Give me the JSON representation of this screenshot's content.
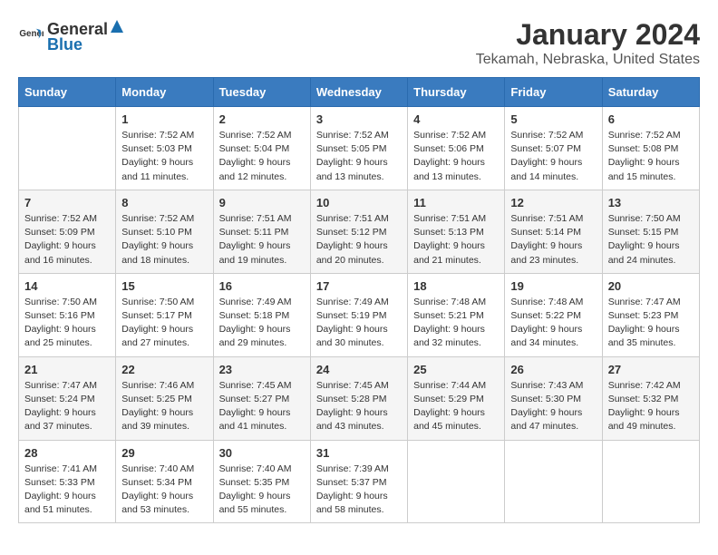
{
  "logo": {
    "general": "General",
    "blue": "Blue"
  },
  "title": "January 2024",
  "location": "Tekamah, Nebraska, United States",
  "days_of_week": [
    "Sunday",
    "Monday",
    "Tuesday",
    "Wednesday",
    "Thursday",
    "Friday",
    "Saturday"
  ],
  "weeks": [
    [
      {
        "day": "",
        "info": ""
      },
      {
        "day": "1",
        "info": "Sunrise: 7:52 AM\nSunset: 5:03 PM\nDaylight: 9 hours\nand 11 minutes."
      },
      {
        "day": "2",
        "info": "Sunrise: 7:52 AM\nSunset: 5:04 PM\nDaylight: 9 hours\nand 12 minutes."
      },
      {
        "day": "3",
        "info": "Sunrise: 7:52 AM\nSunset: 5:05 PM\nDaylight: 9 hours\nand 13 minutes."
      },
      {
        "day": "4",
        "info": "Sunrise: 7:52 AM\nSunset: 5:06 PM\nDaylight: 9 hours\nand 13 minutes."
      },
      {
        "day": "5",
        "info": "Sunrise: 7:52 AM\nSunset: 5:07 PM\nDaylight: 9 hours\nand 14 minutes."
      },
      {
        "day": "6",
        "info": "Sunrise: 7:52 AM\nSunset: 5:08 PM\nDaylight: 9 hours\nand 15 minutes."
      }
    ],
    [
      {
        "day": "7",
        "info": "Sunrise: 7:52 AM\nSunset: 5:09 PM\nDaylight: 9 hours\nand 16 minutes."
      },
      {
        "day": "8",
        "info": "Sunrise: 7:52 AM\nSunset: 5:10 PM\nDaylight: 9 hours\nand 18 minutes."
      },
      {
        "day": "9",
        "info": "Sunrise: 7:51 AM\nSunset: 5:11 PM\nDaylight: 9 hours\nand 19 minutes."
      },
      {
        "day": "10",
        "info": "Sunrise: 7:51 AM\nSunset: 5:12 PM\nDaylight: 9 hours\nand 20 minutes."
      },
      {
        "day": "11",
        "info": "Sunrise: 7:51 AM\nSunset: 5:13 PM\nDaylight: 9 hours\nand 21 minutes."
      },
      {
        "day": "12",
        "info": "Sunrise: 7:51 AM\nSunset: 5:14 PM\nDaylight: 9 hours\nand 23 minutes."
      },
      {
        "day": "13",
        "info": "Sunrise: 7:50 AM\nSunset: 5:15 PM\nDaylight: 9 hours\nand 24 minutes."
      }
    ],
    [
      {
        "day": "14",
        "info": "Sunrise: 7:50 AM\nSunset: 5:16 PM\nDaylight: 9 hours\nand 25 minutes."
      },
      {
        "day": "15",
        "info": "Sunrise: 7:50 AM\nSunset: 5:17 PM\nDaylight: 9 hours\nand 27 minutes."
      },
      {
        "day": "16",
        "info": "Sunrise: 7:49 AM\nSunset: 5:18 PM\nDaylight: 9 hours\nand 29 minutes."
      },
      {
        "day": "17",
        "info": "Sunrise: 7:49 AM\nSunset: 5:19 PM\nDaylight: 9 hours\nand 30 minutes."
      },
      {
        "day": "18",
        "info": "Sunrise: 7:48 AM\nSunset: 5:21 PM\nDaylight: 9 hours\nand 32 minutes."
      },
      {
        "day": "19",
        "info": "Sunrise: 7:48 AM\nSunset: 5:22 PM\nDaylight: 9 hours\nand 34 minutes."
      },
      {
        "day": "20",
        "info": "Sunrise: 7:47 AM\nSunset: 5:23 PM\nDaylight: 9 hours\nand 35 minutes."
      }
    ],
    [
      {
        "day": "21",
        "info": "Sunrise: 7:47 AM\nSunset: 5:24 PM\nDaylight: 9 hours\nand 37 minutes."
      },
      {
        "day": "22",
        "info": "Sunrise: 7:46 AM\nSunset: 5:25 PM\nDaylight: 9 hours\nand 39 minutes."
      },
      {
        "day": "23",
        "info": "Sunrise: 7:45 AM\nSunset: 5:27 PM\nDaylight: 9 hours\nand 41 minutes."
      },
      {
        "day": "24",
        "info": "Sunrise: 7:45 AM\nSunset: 5:28 PM\nDaylight: 9 hours\nand 43 minutes."
      },
      {
        "day": "25",
        "info": "Sunrise: 7:44 AM\nSunset: 5:29 PM\nDaylight: 9 hours\nand 45 minutes."
      },
      {
        "day": "26",
        "info": "Sunrise: 7:43 AM\nSunset: 5:30 PM\nDaylight: 9 hours\nand 47 minutes."
      },
      {
        "day": "27",
        "info": "Sunrise: 7:42 AM\nSunset: 5:32 PM\nDaylight: 9 hours\nand 49 minutes."
      }
    ],
    [
      {
        "day": "28",
        "info": "Sunrise: 7:41 AM\nSunset: 5:33 PM\nDaylight: 9 hours\nand 51 minutes."
      },
      {
        "day": "29",
        "info": "Sunrise: 7:40 AM\nSunset: 5:34 PM\nDaylight: 9 hours\nand 53 minutes."
      },
      {
        "day": "30",
        "info": "Sunrise: 7:40 AM\nSunset: 5:35 PM\nDaylight: 9 hours\nand 55 minutes."
      },
      {
        "day": "31",
        "info": "Sunrise: 7:39 AM\nSunset: 5:37 PM\nDaylight: 9 hours\nand 58 minutes."
      },
      {
        "day": "",
        "info": ""
      },
      {
        "day": "",
        "info": ""
      },
      {
        "day": "",
        "info": ""
      }
    ]
  ]
}
